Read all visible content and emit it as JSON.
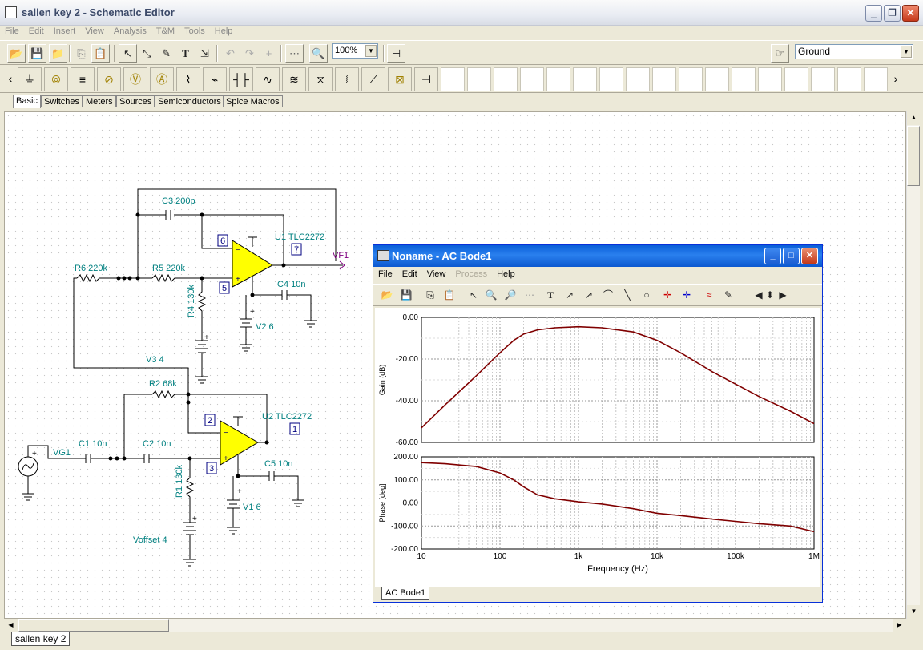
{
  "window": {
    "title": "sallen key 2 - Schematic Editor",
    "min": "_",
    "max": "❐",
    "close": "✕"
  },
  "menu": [
    "File",
    "Edit",
    "Insert",
    "View",
    "Analysis",
    "T&M",
    "Tools",
    "Help"
  ],
  "toolbar": {
    "zoom": "100%",
    "component_select": "Ground",
    "zoom_icon": "zoom-icon"
  },
  "component_tabs": [
    "Basic",
    "Switches",
    "Meters",
    "Sources",
    "Semiconductors",
    "Spice Macros"
  ],
  "document_tab": "sallen key 2",
  "schematic": {
    "labels": {
      "c3": "C3 200p",
      "u1": "U1 TLC2272",
      "vf1": "VF1",
      "r6": "R6 220k",
      "r5": "R5 220k",
      "r4": "R4 130k",
      "c4": "C4 10n",
      "v2": "V2 6",
      "v3": "V3 4",
      "r2": "R2 68k",
      "u2": "U2 TLC2272",
      "vg1": "VG1",
      "c1": "C1 10n",
      "c2": "C2 10n",
      "c5": "C5 10n",
      "r1": "R1 130k",
      "v1": "V1 6",
      "voffset": "Voffset 4"
    },
    "nodes": {
      "n6": "6",
      "n7": "7",
      "n5": "5",
      "n2": "2",
      "n1": "1",
      "n3": "3"
    },
    "colors": {
      "label": "#008080",
      "wire": "#000000",
      "opamp": "#ffff00",
      "vf": "#800080"
    }
  },
  "bode": {
    "title": "Noname - AC Bode1",
    "menu": [
      "File",
      "Edit",
      "View",
      "Process",
      "Help"
    ],
    "menu_disabled": "Process",
    "tab": "AC Bode1",
    "color": "#800000",
    "chart_data": [
      {
        "type": "line",
        "ylabel": "Gain (dB)",
        "xscale": "log",
        "xlim": [
          10,
          1000000
        ],
        "ylim": [
          -60,
          0
        ],
        "yticks": [
          "0.00",
          "-20.00",
          "-40.00",
          "-60.00"
        ],
        "series": [
          {
            "x": [
              10,
              20,
              50,
              100,
              150,
              200,
              300,
              500,
              1000,
              2000,
              5000,
              10000,
              20000,
              50000,
              100000,
              200000,
              500000,
              1000000
            ],
            "y": [
              -53,
              -42,
              -28,
              -17,
              -11,
              -8,
              -6,
              -5,
              -4.5,
              -5,
              -7,
              -11,
              -17,
              -26,
              -32,
              -38,
              -45,
              -51
            ]
          }
        ]
      },
      {
        "type": "line",
        "xlabel": "Frequency (Hz)",
        "ylabel": "Phase [deg]",
        "xscale": "log",
        "xlim": [
          10,
          1000000
        ],
        "ylim": [
          -200,
          200
        ],
        "yticks": [
          "200.00",
          "100.00",
          "0.00",
          "-100.00",
          "-200.00"
        ],
        "xticks": [
          "10",
          "100",
          "1k",
          "10k",
          "100k",
          "1M"
        ],
        "series": [
          {
            "x": [
              10,
              20,
              50,
              100,
              150,
              200,
              300,
              500,
              1000,
              2000,
              5000,
              10000,
              20000,
              50000,
              100000,
              200000,
              500000,
              1000000
            ],
            "y": [
              175,
              170,
              158,
              130,
              100,
              70,
              35,
              18,
              5,
              -5,
              -25,
              -45,
              -55,
              -70,
              -80,
              -90,
              -100,
              -125
            ]
          }
        ]
      }
    ]
  }
}
